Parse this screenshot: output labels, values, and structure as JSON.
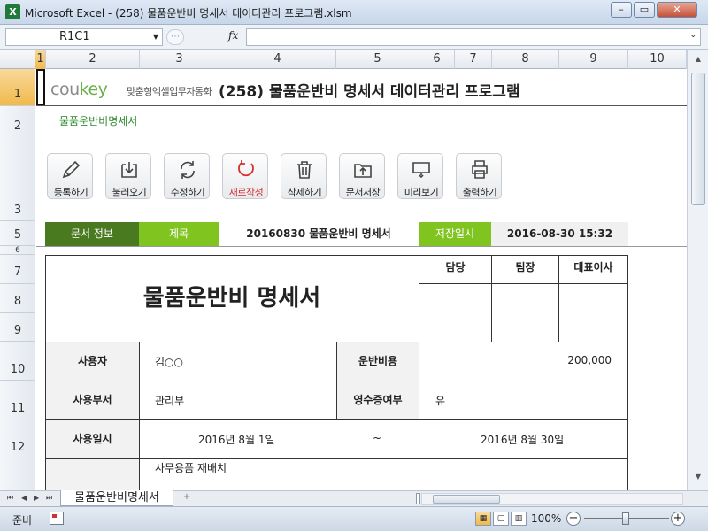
{
  "window": {
    "app_icon": "X",
    "title": "Microsoft Excel - (258) 물품운반비 명세서 데이터관리 프로그램.xlsm",
    "minimize": "–",
    "restore": "▭",
    "close": "✕"
  },
  "formula_bar": {
    "name_box": "R1C1",
    "fx_label": "fx",
    "formula": ""
  },
  "columns": [
    "1",
    "2",
    "3",
    "4",
    "5",
    "6",
    "7",
    "8",
    "9",
    "10"
  ],
  "rows": [
    "1",
    "2",
    "3",
    "5",
    "6",
    "7",
    "8",
    "9",
    "10",
    "11",
    "12"
  ],
  "sheet": {
    "logo_main": "cou",
    "logo_accent": "key",
    "logo_sub": "맞춤형엑셀업무자동화",
    "title": "(258) 물품운반비 명세서 데이터관리 프로그램",
    "subtitle": "물품운반비명세서",
    "buttons": [
      {
        "label": "등록하기",
        "icon": "pencil-icon"
      },
      {
        "label": "불러오기",
        "icon": "download-icon"
      },
      {
        "label": "수정하기",
        "icon": "refresh-icon"
      },
      {
        "label": "새로작성",
        "icon": "new-icon"
      },
      {
        "label": "삭제하기",
        "icon": "trash-icon"
      },
      {
        "label": "문서저장",
        "icon": "folder-save-icon"
      },
      {
        "label": "미리보기",
        "icon": "monitor-icon"
      },
      {
        "label": "출력하기",
        "icon": "printer-icon"
      }
    ],
    "info": {
      "doc_info_label": "문서 정보",
      "title_label": "제목",
      "title_value": "20160830 물품운반비 명세서",
      "saved_label": "저장일시",
      "saved_value": "2016-08-30 15:32"
    },
    "document": {
      "heading": "물품운반비 명세서",
      "approvals": [
        "담당",
        "팀장",
        "대표이사"
      ],
      "user_label": "사용자",
      "user_value": "김○○",
      "cost_label": "운반비용",
      "cost_value": "200,000",
      "dept_label": "사용부서",
      "dept_value": "관리부",
      "receipt_label": "영수증여부",
      "receipt_value": "유",
      "date_label": "사용일시",
      "date_from": "2016년 8월 1일",
      "date_sep": "~",
      "date_to": "2016년 8월 30일",
      "purpose_value": "사무용품 재배치"
    }
  },
  "tabs": {
    "nav": [
      "⏮",
      "◀",
      "▶",
      "⏭"
    ],
    "active": "물품운반비명세서",
    "new_sheet": "+"
  },
  "status": {
    "ready": "준비",
    "zoom": "100%",
    "zoom_out": "−",
    "zoom_in": "+"
  }
}
